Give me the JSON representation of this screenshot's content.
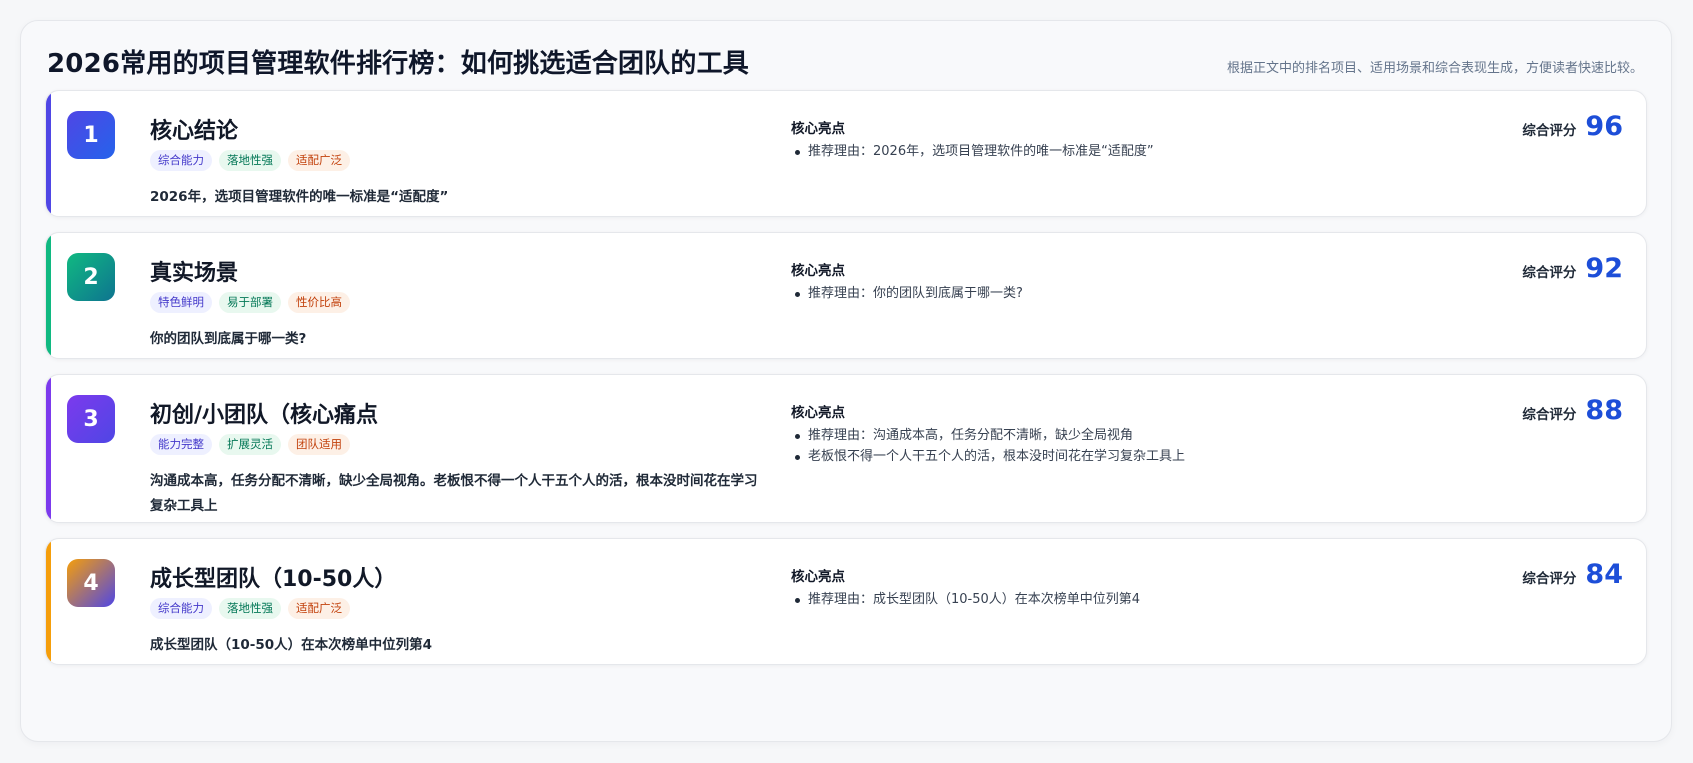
{
  "header": {
    "title": "2026常用的项目管理软件排行榜：如何挑选适合团队的工具",
    "subtitle": "根据正文中的排名项目、适用场景和综合表现生成，方便读者快速比较。"
  },
  "highlight_heading": "核心亮点",
  "score_label": "综合评分",
  "colors": {
    "score": "#1d4ed8",
    "card1_accent": "#4f46e5",
    "card2_accent": "#10b981",
    "card3_accent": "#7c3aed",
    "card4_accent": "#f59e0b"
  },
  "cards": [
    {
      "rank": "1",
      "title": "核心结论",
      "tags": [
        "综合能力",
        "落地性强",
        "适配广泛"
      ],
      "desc": "2026年，选项目管理软件的唯一标准是“适配度”",
      "highlights": [
        "推荐理由：2026年，选项目管理软件的唯一标准是“适配度”"
      ],
      "score": "96"
    },
    {
      "rank": "2",
      "title": "真实场景",
      "tags": [
        "特色鲜明",
        "易于部署",
        "性价比高"
      ],
      "desc": "你的团队到底属于哪一类?",
      "highlights": [
        "推荐理由：你的团队到底属于哪一类?"
      ],
      "score": "92"
    },
    {
      "rank": "3",
      "title": "初创/小团队（核心痛点",
      "tags": [
        "能力完整",
        "扩展灵活",
        "团队适用"
      ],
      "desc": "沟通成本高，任务分配不清晰，缺少全局视角。老板恨不得一个人干五个人的活，根本没时间花在学习复杂工具上",
      "highlights": [
        "推荐理由：沟通成本高，任务分配不清晰，缺少全局视角",
        "老板恨不得一个人干五个人的活，根本没时间花在学习复杂工具上"
      ],
      "score": "88"
    },
    {
      "rank": "4",
      "title": "成长型团队（10-50人）",
      "tags": [
        "综合能力",
        "落地性强",
        "适配广泛"
      ],
      "desc": "成长型团队（10-50人）在本次榜单中位列第4",
      "highlights": [
        "推荐理由：成长型团队（10-50人）在本次榜单中位列第4"
      ],
      "score": "84"
    }
  ]
}
